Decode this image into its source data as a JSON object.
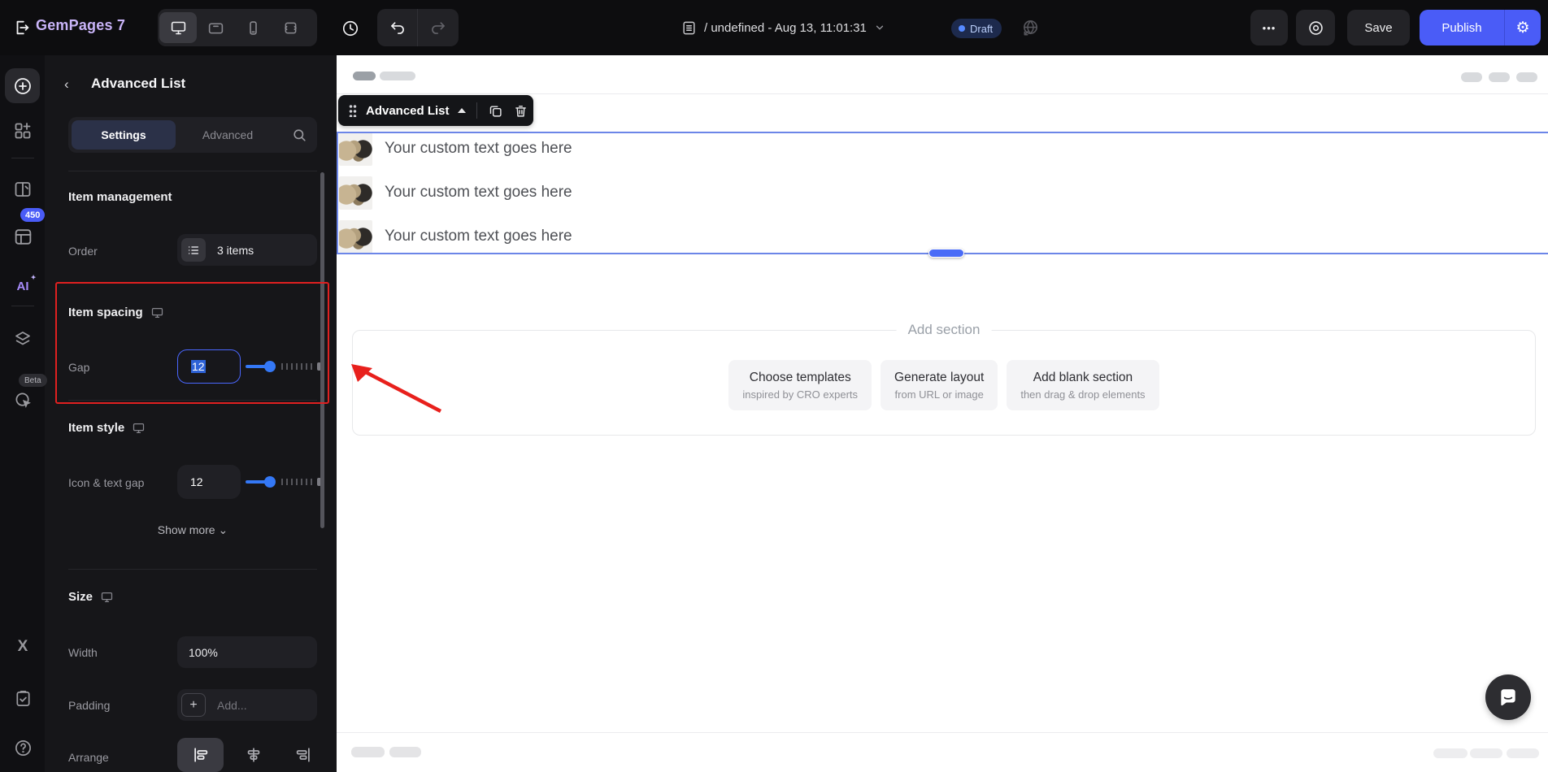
{
  "topbar": {
    "brand": "GemPages 7",
    "page_title": "/ undefined - Aug 13, 11:01:31",
    "draft_label": "Draft",
    "more_label": "•••",
    "save_label": "Save",
    "publish_label": "Publish",
    "gear_glyph": "⚙"
  },
  "rail": {
    "credits_badge": "450",
    "ai_label": "AI",
    "beta_label": "Beta",
    "x_label": "X",
    "help_glyph": "?"
  },
  "panel": {
    "title": "Advanced List",
    "back_glyph": "‹",
    "tabs": {
      "settings": "Settings",
      "advanced": "Advanced"
    },
    "item_management": {
      "heading": "Item management",
      "order_label": "Order",
      "order_value": "3 items"
    },
    "item_spacing": {
      "heading": "Item spacing",
      "gap_label": "Gap",
      "gap_value": "12"
    },
    "item_style": {
      "heading": "Item style",
      "icon_text_gap_label": "Icon & text gap",
      "icon_text_gap_value": "12"
    },
    "show_more_label": "Show more ⌄",
    "size": {
      "heading": "Size",
      "width_label": "Width",
      "width_value": "100%",
      "padding_label": "Padding",
      "padding_add_glyph": "+",
      "padding_placeholder": "Add...",
      "arrange_label": "Arrange"
    }
  },
  "canvas": {
    "toolbar_label": "Advanced List",
    "list_items": [
      {
        "text": "Your custom text goes here"
      },
      {
        "text": "Your custom text goes here"
      },
      {
        "text": "Your custom text goes here"
      }
    ],
    "add_section": {
      "label": "Add section",
      "buttons": [
        {
          "title": "Choose templates",
          "subtitle": "inspired by CRO experts"
        },
        {
          "title": "Generate layout",
          "subtitle": "from URL or image"
        },
        {
          "title": "Add blank section",
          "subtitle": "then drag & drop elements"
        }
      ]
    }
  },
  "colors": {
    "accent_blue": "#4a5cf7",
    "slider_blue": "#3478f6",
    "selection_blue": "#6c86e8",
    "annotation_red": "#e02020",
    "draft_text": "#bcd0fb"
  }
}
